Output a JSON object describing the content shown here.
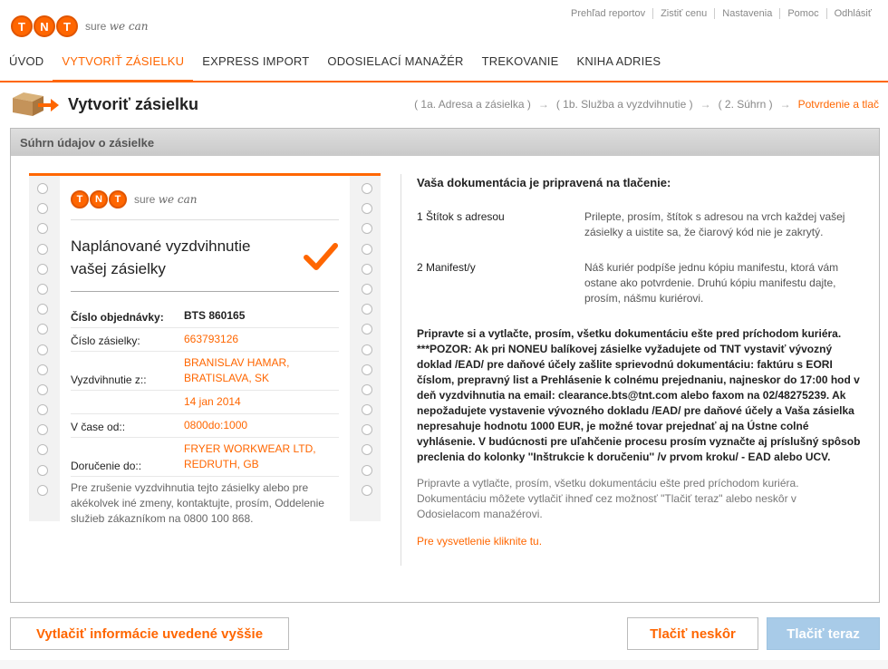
{
  "brand": {
    "logo_letters": [
      "T",
      "N",
      "T"
    ],
    "slogan_prefix": "sure",
    "slogan_script": "we can",
    "accent_color": "#ff6600"
  },
  "toplinks": [
    "Prehľad reportov",
    "Zistiť cenu",
    "Nastavenia",
    "Pomoc",
    "Odhlásiť"
  ],
  "nav": {
    "items": [
      {
        "label": "ÚVOD",
        "active": false
      },
      {
        "label": "VYTVORIŤ ZÁSIELKU",
        "active": true
      },
      {
        "label": "EXPRESS IMPORT",
        "active": false
      },
      {
        "label": "ODOSIELACÍ MANAŽÉR",
        "active": false
      },
      {
        "label": "TREKOVANIE",
        "active": false
      },
      {
        "label": "KNIHA ADRIES",
        "active": false
      }
    ]
  },
  "page": {
    "title": "Vytvoriť zásielku",
    "steps": [
      "( 1a. Adresa a zásielka )",
      "( 1b. Služba a vyzdvihnutie )",
      "( 2. Súhrn )",
      "Potvrdenie a tlač"
    ],
    "step_arrow": "→"
  },
  "summary": {
    "header": "Súhrn údajov o zásielke",
    "card": {
      "title": "Naplánované vyzdvihnutie vašej zásielky",
      "rows": [
        {
          "label": "Číslo objednávky:",
          "value": "BTS 860165",
          "style": "dark"
        },
        {
          "label": "Číslo zásielky:",
          "value": "663793126"
        },
        {
          "label": "Vyzdvihnutie z::",
          "value": "BRANISLAV HAMAR, BRATISLAVA, SK"
        },
        {
          "label": "",
          "value": "14 jan 2014"
        },
        {
          "label": "V čase od::",
          "value": "0800do:1000"
        },
        {
          "label": "Doručenie do::",
          "value": "FRYER WORKWEAR LTD, REDRUTH, GB"
        }
      ],
      "note": "Pre zrušenie vyzdvihnutia tejto zásielky alebo pre akékolvek iné zmeny, kontaktujte, prosím, Oddelenie služieb zákazníkom na 0800 100 868."
    },
    "docs": {
      "heading": "Vaša dokumentácia je pripravená na tlačenie:",
      "items": [
        {
          "name": "1 Štítok s adresou",
          "desc": "Prilepte, prosím, štítok s adresou na vrch každej vašej zásielky a uistite sa, že čiarový kód nie je zakrytý."
        },
        {
          "name": "2 Manifest/y",
          "desc": "Náš kuriér podpíše jednu kópiu manifestu, ktorá vám ostane ako potvrdenie. Druhú kópiu manifestu dajte, prosím, nášmu kuriérovi."
        }
      ],
      "warning": "Pripravte si a vytlačte, prosím, všetku dokumentáciu ešte pred príchodom kuriéra. ***POZOR: Ak pri NONEU balíkovej zásielke vyžadujete od TNT vystaviť vývozný doklad /EAD/ pre daňové účely zašlite sprievodnú dokumentáciu: faktúru s EORI číslom, prepravný list a Prehlásenie k colnému prejednaniu, najneskor do 17:00 hod v deň vyzdvihnutia na email: clearance.bts@tnt.com alebo faxom na 02/48275239. Ak nepožadujete vystavenie vývozného dokladu /EAD/ pre daňové účely a Vaša zásielka nepresahuje hodnotu 1000 EUR, je možné tovar prejednať aj na Ústne colné vyhlásenie. V budúcnosti pre uľahčenie procesu prosím vyznačte aj príslušný spôsob preclenia do kolonky ''Inštrukcie k doručeniu'' /v prvom kroku/ - EAD alebo UCV.",
      "info": "Pripravte a vytlačte, prosím, všetku dokumentáciu ešte pred príchodom kuriéra. Dokumentáciu môžete vytlačiť ihneď cez možnosť \"Tlačiť teraz\" alebo neskôr v Odosielacom manažérovi.",
      "link": "Pre vysvetlenie kliknite tu."
    }
  },
  "buttons": {
    "print_info": "Vytlačiť informácie uvedené vyššie",
    "print_later": "Tlačiť neskôr",
    "print_now": "Tlačiť teraz"
  }
}
